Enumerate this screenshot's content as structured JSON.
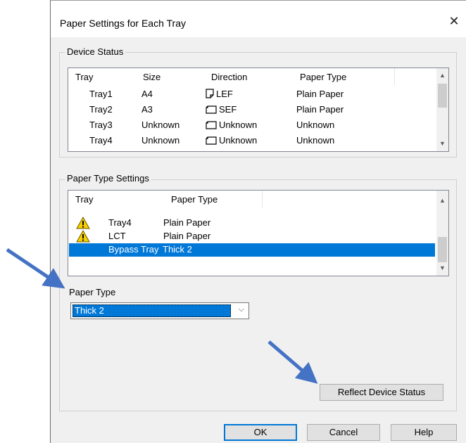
{
  "dialog": {
    "title": "Paper Settings for Each Tray",
    "close_glyph": "✕"
  },
  "device_status": {
    "group_label": "Device Status",
    "columns": [
      "Tray",
      "Size",
      "Direction",
      "Paper Type"
    ],
    "rows": [
      {
        "tray": "Tray1",
        "size": "A4",
        "direction": "LEF",
        "direction_icon": "portrait-page-icon",
        "paper_type": "Plain Paper"
      },
      {
        "tray": "Tray2",
        "size": "A3",
        "direction": "SEF",
        "direction_icon": "landscape-page-icon",
        "paper_type": "Plain Paper"
      },
      {
        "tray": "Tray3",
        "size": "Unknown",
        "direction": "Unknown",
        "direction_icon": "landscape-page-icon",
        "paper_type": "Unknown"
      },
      {
        "tray": "Tray4",
        "size": "Unknown",
        "direction": "Unknown",
        "direction_icon": "landscape-page-icon",
        "paper_type": "Unknown"
      }
    ]
  },
  "paper_type_settings": {
    "group_label": "Paper Type Settings",
    "columns": [
      "Tray",
      "Paper Type"
    ],
    "rows": [
      {
        "icon": "warning-icon",
        "tray": "Tray4",
        "paper_type": "Plain Paper",
        "selected": false
      },
      {
        "icon": "warning-icon",
        "tray": "LCT",
        "paper_type": "Plain Paper",
        "selected": false
      },
      {
        "icon": "",
        "tray": "Bypass Tray",
        "paper_type": "Thick 2",
        "selected": true
      }
    ]
  },
  "paper_type": {
    "label": "Paper Type",
    "selected_value": "Thick 2"
  },
  "buttons": {
    "reflect": "Reflect Device Status",
    "ok": "OK",
    "cancel": "Cancel",
    "help": "Help"
  },
  "colors": {
    "selection": "#0078d7",
    "annotation_arrow": "#4472c4",
    "warning": "#f5d000"
  }
}
